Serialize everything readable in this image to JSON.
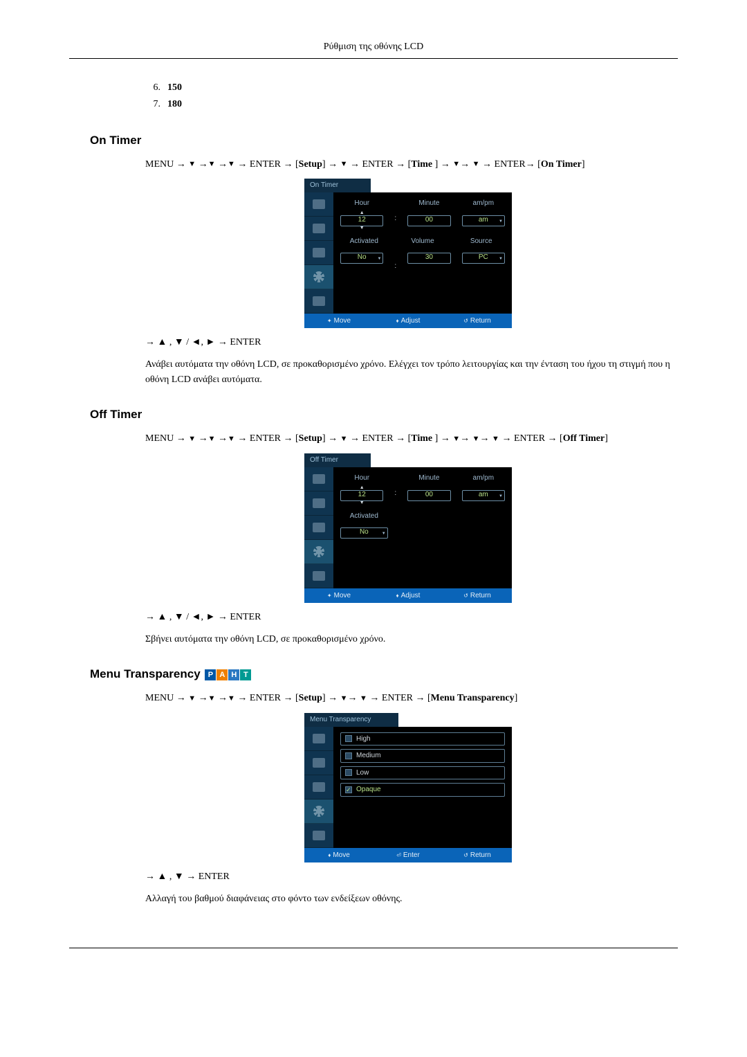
{
  "header": {
    "title": "Ρύθμιση της οθόνης LCD"
  },
  "top_list": [
    {
      "num": "6.",
      "val": "150"
    },
    {
      "num": "7.",
      "val": "180"
    }
  ],
  "sections": {
    "on_timer": {
      "heading": "On Timer",
      "nav": {
        "pre": "MENU → ",
        "mid1": " → ENTER → [",
        "setup": "Setup",
        "mid2": "] → ",
        "mid3": " → ENTER → [",
        "time": "Time",
        "mid4": " ] → ",
        "mid5": " → ENTER→ [",
        "target": "On Timer",
        "end": "]"
      },
      "osd": {
        "title": "On Timer",
        "labels": {
          "hour": "Hour",
          "minute": "Minute",
          "ampm": "am/pm",
          "activated": "Activated",
          "volume": "Volume",
          "source": "Source"
        },
        "values": {
          "hour": "12",
          "minute": "00",
          "ampm": "am",
          "activated": "No",
          "volume": "30",
          "source": "PC"
        },
        "footer": {
          "move": "Move",
          "adjust": "Adjust",
          "return": "Return"
        }
      },
      "post_nav": "→ ▲ , ▼ / ◄, ► → ENTER",
      "desc": "Ανάβει αυτόματα την οθόνη LCD, σε προκαθορισμένο χρόνο. Ελέγχει τον τρόπο λειτουργίας και την ένταση του ήχου τη στιγμή που η οθόνη LCD ανάβει αυτόματα."
    },
    "off_timer": {
      "heading": "Off Timer",
      "nav": {
        "pre": "MENU → ",
        "mid1": " → ENTER → [",
        "setup": "Setup",
        "mid2": "] → ",
        "mid3": " → ENTER → [",
        "time": "Time",
        "mid4": " ] → ",
        "mid5": " → ENTER → [",
        "target": "Off Timer",
        "end": "]"
      },
      "osd": {
        "title": "Off Timer",
        "labels": {
          "hour": "Hour",
          "minute": "Minute",
          "ampm": "am/pm",
          "activated": "Activated"
        },
        "values": {
          "hour": "12",
          "minute": "00",
          "ampm": "am",
          "activated": "No"
        },
        "footer": {
          "move": "Move",
          "adjust": "Adjust",
          "return": "Return"
        }
      },
      "post_nav": "→ ▲ , ▼ / ◄, ► → ENTER",
      "desc": "Σβήνει αυτόματα την οθόνη LCD, σε προκαθορισμένο χρόνο."
    },
    "menu_transparency": {
      "heading": "Menu Transparency",
      "badges": [
        "P",
        "A",
        "H",
        "T"
      ],
      "nav": {
        "pre": "MENU → ",
        "mid1": " → ENTER → [",
        "setup": "Setup",
        "mid2": "] → ",
        "mid3": " → ENTER → [",
        "target": "Menu Transparency",
        "end": "]"
      },
      "osd": {
        "title": "Menu Transparency",
        "options": [
          "High",
          "Medium",
          "Low",
          "Opaque"
        ],
        "selected": "Opaque",
        "footer": {
          "move": "Move",
          "enter": "Enter",
          "return": "Return"
        }
      },
      "post_nav": "→ ▲ , ▼ → ENTER",
      "desc": "Αλλαγή του βαθμού διαφάνειας στο φόντο των ενδείξεων οθόνης."
    }
  }
}
